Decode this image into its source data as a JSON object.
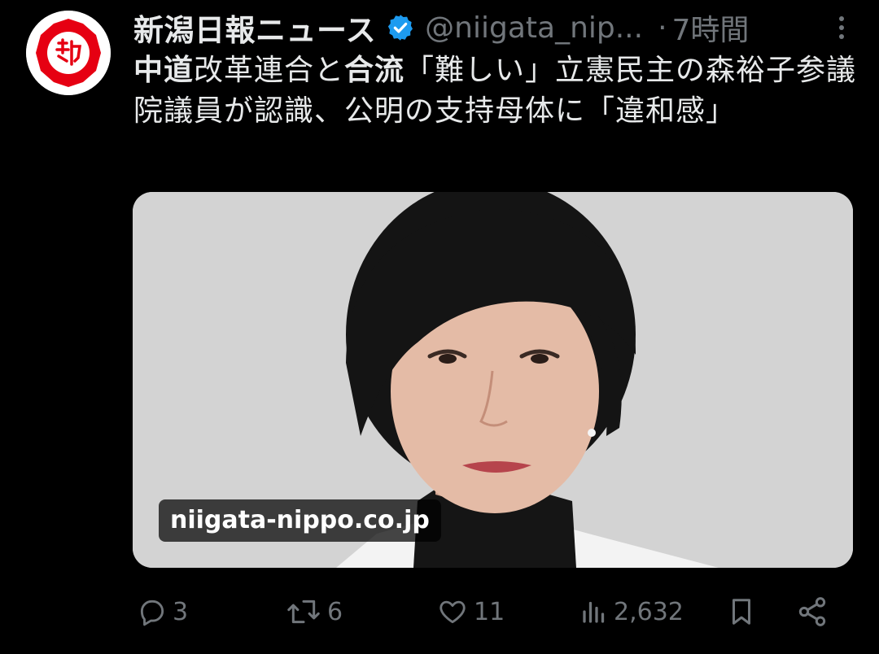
{
  "account": {
    "display_name": "新潟日報ニュース",
    "handle": "@niigata_nip...",
    "separator": "·",
    "time": "7時間",
    "verified": true,
    "brand_color": "#e60012",
    "verified_color": "#1d9bf0"
  },
  "tweet": {
    "text_parts": [
      {
        "text": "中道",
        "bold": true
      },
      {
        "text": "改革連合と",
        "bold": false
      },
      {
        "text": "合流",
        "bold": true
      },
      {
        "text": "「難しい」立憲民主の森裕子参議院議員が認識、公明の支持母体に「違和感」",
        "bold": false
      }
    ]
  },
  "media": {
    "domain_label": "niigata-nippo.co.jp"
  },
  "actions": {
    "reply_count": "3",
    "retweet_count": "6",
    "like_count": "11",
    "view_count": "2,632"
  },
  "icons": {
    "avatar": "niigata-nippo-logo-icon",
    "verified": "verified-badge-icon",
    "more": "more-vertical-icon",
    "reply": "reply-icon",
    "retweet": "retweet-icon",
    "like": "heart-icon",
    "views": "views-icon",
    "bookmark": "bookmark-icon",
    "share": "share-icon"
  }
}
